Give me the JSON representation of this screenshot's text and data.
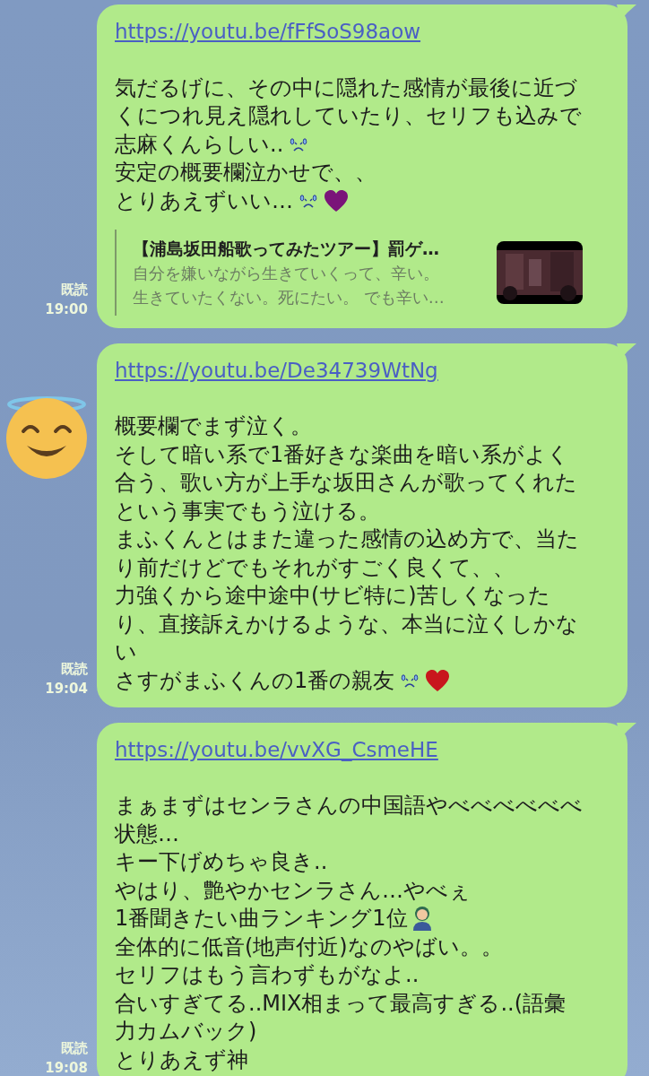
{
  "messages": [
    {
      "avatar": false,
      "link": "https://youtu.be/fFfSoS98aow",
      "lines": [
        {
          "text": "気だるげに、その中に隠れた感情が最後に近づ"
        },
        {
          "text": "くにつれ見え隠れしていたり、セリフも込みで"
        },
        {
          "text": "志麻くんらしい..",
          "emoji": [
            {
              "kind": "sweat"
            }
          ]
        },
        {
          "text": "安定の概要欄泣かせで、、"
        },
        {
          "text": "とりあえずいい…",
          "emoji": [
            {
              "kind": "sweat"
            },
            {
              "kind": "heart",
              "color": "#7a1479"
            }
          ]
        }
      ],
      "preview": {
        "title": "【浦島坂田船歌ってみたツアー】罰ゲ…",
        "description": "自分を嫌いながら生きていくって、辛い。生きていたくない。死にたい。 でも辛い…"
      },
      "read": "既読",
      "time": "19:00"
    },
    {
      "avatar": true,
      "link": "https://youtu.be/De34739WtNg",
      "lines": [
        {
          "text": "概要欄でまず泣く。"
        },
        {
          "text": "そして暗い系で1番好きな楽曲を暗い系がよく"
        },
        {
          "text": "合う、歌い方が上手な坂田さんが歌ってくれた"
        },
        {
          "text": "という事実でもう泣ける。"
        },
        {
          "text": "まふくんとはまた違った感情の込め方で、当た"
        },
        {
          "text": "り前だけどでもそれがすごく良くて、、"
        },
        {
          "text": "力強くから途中途中(サビ特に)苦しくなった"
        },
        {
          "text": "り、直接訴えかけるような、本当に泣くしかな"
        },
        {
          "text": "い"
        },
        {
          "text": "さすがまふくんの1番の親友",
          "emoji": [
            {
              "kind": "sweat"
            },
            {
              "kind": "heart",
              "color": "#c8161d"
            }
          ]
        }
      ],
      "read": "既読",
      "time": "19:04"
    },
    {
      "avatar": false,
      "link": "https://youtu.be/vvXG_CsmeHE",
      "lines": [
        {
          "text": "まぁまずはセンラさんの中国語やべべべべべべ"
        },
        {
          "text": "状態…"
        },
        {
          "text": "キー下げめちゃ良き.."
        },
        {
          "text": "やはり、艶やかセンラさん…やべぇ"
        },
        {
          "text": "1番聞きたい曲ランキング1位",
          "emoji": [
            {
              "kind": "person"
            }
          ]
        },
        {
          "text": "全体的に低音(地声付近)なのやばい。。"
        },
        {
          "text": "セリフはもう言わずもがなよ.."
        },
        {
          "text": "合いすぎてる..MIX相まって最高すぎる..(語彙"
        },
        {
          "text": "力カムバック)"
        },
        {
          "text": "とりあえず神"
        }
      ],
      "read": "既読",
      "time": "19:08"
    }
  ]
}
